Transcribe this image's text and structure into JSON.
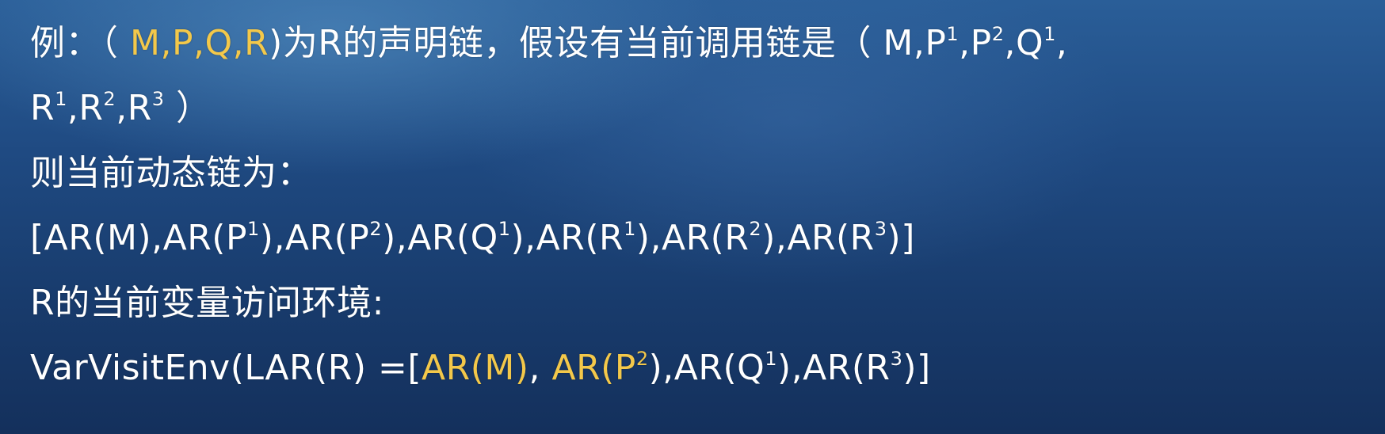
{
  "colors": {
    "text": "#ffffff",
    "highlight": "#f3c84a",
    "background": "#1c4478"
  },
  "lines": [
    [
      {
        "t": "例：（ "
      },
      {
        "t": "M,P,Q,R",
        "hl": true
      },
      {
        "t": ")为R的声明链，假设有当前调用链是（ M,P"
      },
      {
        "t": "1",
        "sup": true
      },
      {
        "t": ",P"
      },
      {
        "t": "2",
        "sup": true
      },
      {
        "t": ",Q"
      },
      {
        "t": "1",
        "sup": true
      },
      {
        "t": ","
      }
    ],
    [
      {
        "t": "R"
      },
      {
        "t": "1",
        "sup": true
      },
      {
        "t": ",R"
      },
      {
        "t": "2",
        "sup": true
      },
      {
        "t": ",R"
      },
      {
        "t": "3",
        "sup": true
      },
      {
        "t": " ）"
      }
    ],
    [
      {
        "t": "则当前动态链为："
      }
    ],
    [
      {
        "t": "[AR(M),AR(P"
      },
      {
        "t": "1",
        "sup": true
      },
      {
        "t": "),AR(P"
      },
      {
        "t": "2",
        "sup": true
      },
      {
        "t": "),AR(Q"
      },
      {
        "t": "1",
        "sup": true
      },
      {
        "t": "),AR(R"
      },
      {
        "t": "1",
        "sup": true
      },
      {
        "t": "),AR(R"
      },
      {
        "t": "2",
        "sup": true
      },
      {
        "t": "),AR(R"
      },
      {
        "t": "3",
        "sup": true
      },
      {
        "t": ")]"
      }
    ],
    [
      {
        "t": "R的当前变量访问环境:"
      }
    ],
    [
      {
        "t": "VarVisitEnv(LAR(R) =["
      },
      {
        "t": "AR(M)",
        "hl": true
      },
      {
        "t": ", "
      },
      {
        "t": "AR(P",
        "hl": true
      },
      {
        "t": "2",
        "sup": true,
        "hl": true
      },
      {
        "t": "),AR(Q"
      },
      {
        "t": "1",
        "sup": true
      },
      {
        "t": "),AR(R"
      },
      {
        "t": "3",
        "sup": true
      },
      {
        "t": ")]"
      }
    ]
  ]
}
